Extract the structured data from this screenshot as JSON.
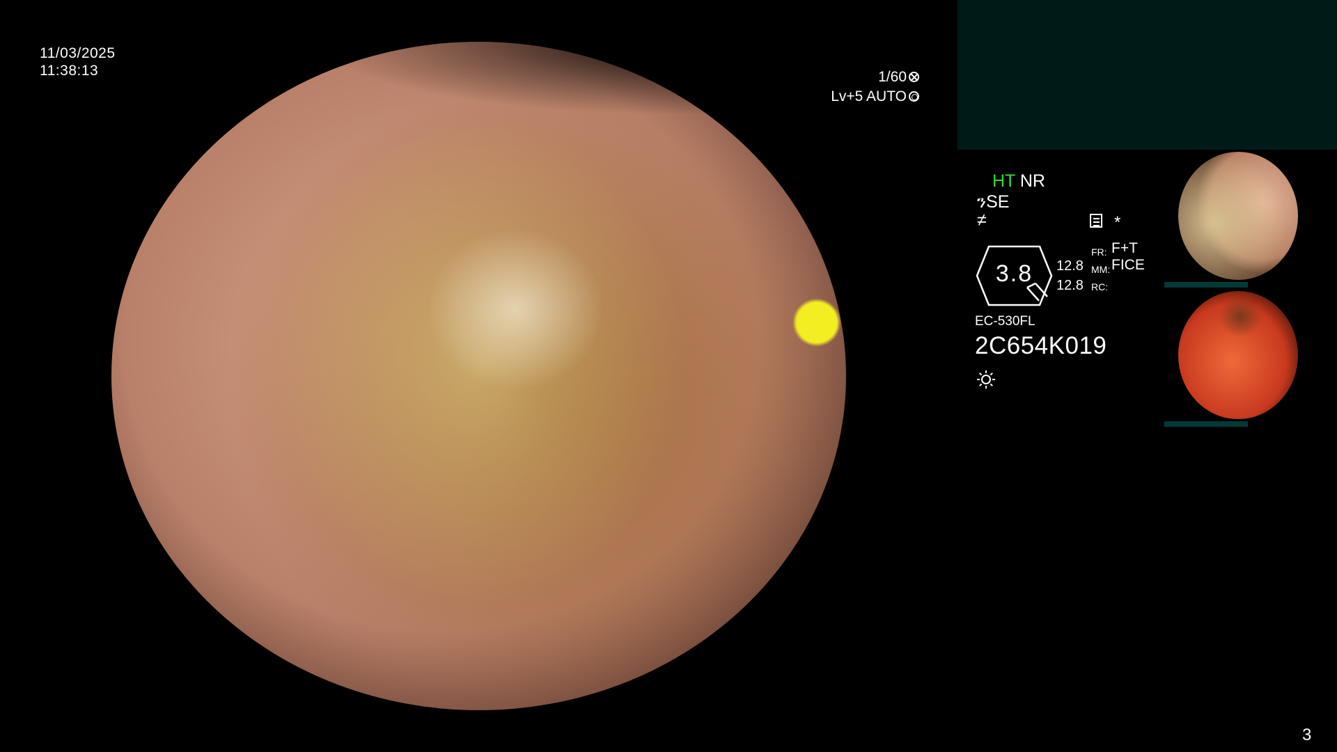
{
  "overlay": {
    "date": "11/03/2025",
    "time": "11:38:13",
    "shutter": "1/60",
    "shutter_icon": "shutter-icon",
    "level": "Lv+5 AUTO",
    "level_icon": "iris-icon"
  },
  "side_panel": {
    "ht_label": "HT",
    "nr_label": "NR",
    "se_label": "SE",
    "se_icon": "structure-enhance-icon",
    "f_icon": "color-f-icon",
    "memo_icon": "memo-icon",
    "star": "*",
    "zoom_value": "3.8",
    "num1": "12.8",
    "num2": "12.8",
    "fr_label": "FR:",
    "fr_value": "F+T",
    "mm_label": "MM:",
    "mm_value": "FICE",
    "rc_label": "RC:",
    "model": "EC-530FL",
    "serial": "2C654K019",
    "light_icon": "sun-icon"
  },
  "thumbnails": [
    {
      "name": "thumbnail-1"
    },
    {
      "name": "thumbnail-2"
    }
  ],
  "page_number": "3",
  "colors": {
    "ht_green": "#33dd33",
    "top_panel": "#001a18"
  }
}
